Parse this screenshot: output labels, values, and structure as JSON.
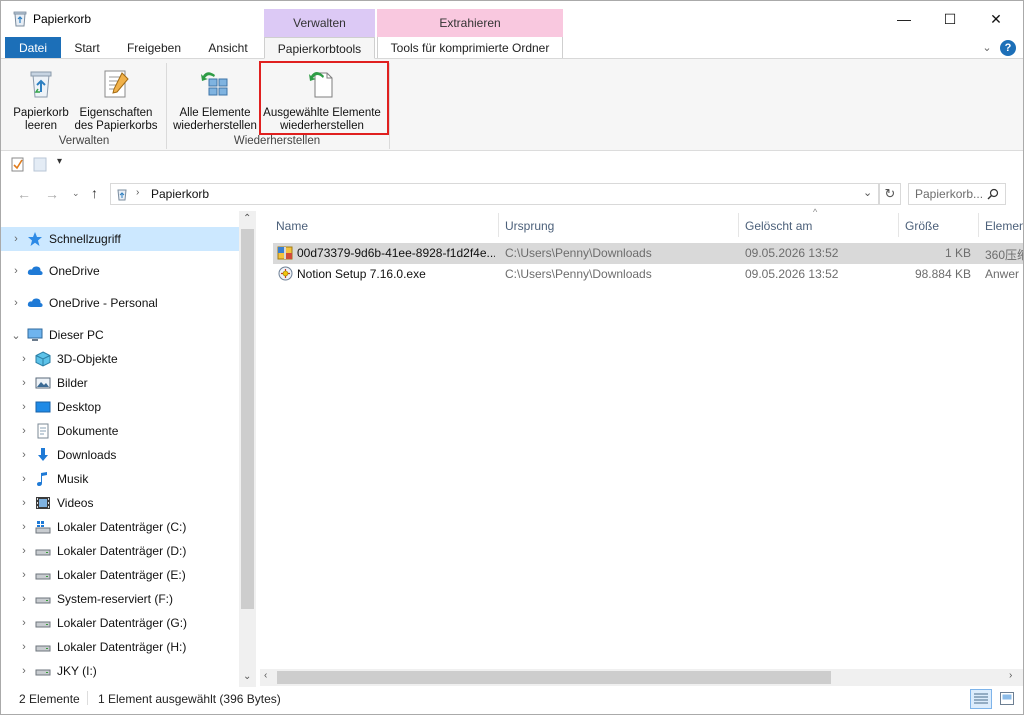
{
  "window": {
    "title": "Papierkorb",
    "controls": {
      "minimize": "—",
      "maximize": "☐",
      "close": "✕"
    }
  },
  "context_groups": [
    {
      "label": "Verwalten",
      "color": "#dcc9f5"
    },
    {
      "label": "Extrahieren",
      "color": "#f9c8df"
    }
  ],
  "tabs": [
    {
      "label": "Datei"
    },
    {
      "label": "Start"
    },
    {
      "label": "Freigeben"
    },
    {
      "label": "Ansicht"
    },
    {
      "label": "Papierkorbtools"
    },
    {
      "label": "Tools für komprimierte Ordner"
    }
  ],
  "ribbon": {
    "groups": [
      {
        "label": "Verwalten",
        "buttons": [
          {
            "label_line1": "Papierkorb",
            "label_line2": "leeren",
            "icon": "recycle-bin-icon"
          },
          {
            "label_line1": "Eigenschaften",
            "label_line2": "des Papierkorbs",
            "icon": "properties-icon"
          }
        ]
      },
      {
        "label": "Wiederherstellen",
        "buttons": [
          {
            "label_line1": "Alle Elemente",
            "label_line2": "wiederherstellen",
            "icon": "restore-all-icon"
          },
          {
            "label_line1": "Ausgewählte Elemente",
            "label_line2": "wiederherstellen",
            "icon": "restore-selected-icon",
            "highlighted": true
          }
        ]
      }
    ]
  },
  "address": {
    "path": "Papierkorb",
    "search_placeholder": "Papierkorb..."
  },
  "nav": {
    "items": [
      {
        "label": "Schnellzugriff",
        "icon": "star-icon",
        "level": 0,
        "selected": true
      },
      {
        "label": "OneDrive",
        "icon": "cloud-icon",
        "level": 0
      },
      {
        "label": "OneDrive - Personal",
        "icon": "cloud-icon",
        "level": 0
      },
      {
        "label": "Dieser PC",
        "icon": "pc-icon",
        "level": 0,
        "expanded": true
      },
      {
        "label": "3D-Objekte",
        "icon": "cube-icon",
        "level": 1
      },
      {
        "label": "Bilder",
        "icon": "pictures-icon",
        "level": 1
      },
      {
        "label": "Desktop",
        "icon": "desktop-icon",
        "level": 1
      },
      {
        "label": "Dokumente",
        "icon": "documents-icon",
        "level": 1
      },
      {
        "label": "Downloads",
        "icon": "downloads-icon",
        "level": 1
      },
      {
        "label": "Musik",
        "icon": "music-icon",
        "level": 1
      },
      {
        "label": "Videos",
        "icon": "videos-icon",
        "level": 1
      },
      {
        "label": "Lokaler Datenträger (C:)",
        "icon": "system-drive-icon",
        "level": 1
      },
      {
        "label": "Lokaler Datenträger (D:)",
        "icon": "drive-icon",
        "level": 1
      },
      {
        "label": "Lokaler Datenträger (E:)",
        "icon": "drive-icon",
        "level": 1
      },
      {
        "label": "System-reserviert (F:)",
        "icon": "drive-icon",
        "level": 1
      },
      {
        "label": "Lokaler Datenträger (G:)",
        "icon": "drive-icon",
        "level": 1
      },
      {
        "label": "Lokaler Datenträger (H:)",
        "icon": "drive-icon",
        "level": 1
      },
      {
        "label": "JKY (I:)",
        "icon": "drive-icon",
        "level": 1
      }
    ]
  },
  "columns": {
    "name": "Name",
    "origin": "Ursprung",
    "deleted": "Gelöscht am",
    "size": "Größe",
    "type": "Elemen"
  },
  "files": [
    {
      "name": "00d73379-9d6b-41ee-8928-f1d2f4e...",
      "origin": "C:\\Users\\Penny\\Downloads",
      "deleted": "09.05.2026 13:52",
      "size": "1 KB",
      "type": "360压缩",
      "icon": "zip-archive-icon",
      "selected": true
    },
    {
      "name": "Notion Setup 7.16.0.exe",
      "origin": "C:\\Users\\Penny\\Downloads",
      "deleted": "09.05.2026 13:52",
      "size": "98.884 KB",
      "type": "Anwer",
      "icon": "setup-exe-icon",
      "selected": false
    }
  ],
  "status": {
    "count": "2 Elemente",
    "selection": "1 Element ausgewählt (396 Bytes)"
  },
  "accent": "#1c6fb8",
  "highlight_color": "#e0201f"
}
